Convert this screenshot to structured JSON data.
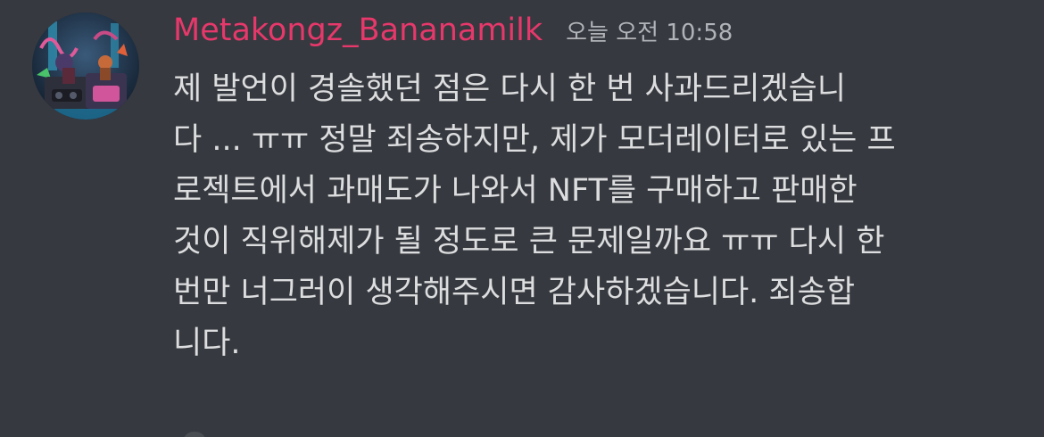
{
  "message": {
    "author": "Metakongz_Bananamilk",
    "timestamp": "오늘 오전 10:58",
    "lines": [
      "제 발언이 경솔했던 점은 다시 한 번 사과드리겠습니",
      "다 ... ㅠㅠ 정말 죄송하지만, 제가 모더레이터로 있는 프",
      "로젝트에서 과매도가 나와서 NFT를 구매하고 판매한",
      "것이 직위해제가 될 정도로 큰 문제일까요 ㅠㅠ 다시 한",
      "번만 너그러이 생각해주시면 감사하겠습니다. 죄송합",
      "니다."
    ]
  },
  "colors": {
    "background": "#36393f",
    "username": "#e6386b",
    "timestamp": "#b0b3b8",
    "text": "#dcddde"
  },
  "icons": {
    "avatar": "avatar-image"
  }
}
